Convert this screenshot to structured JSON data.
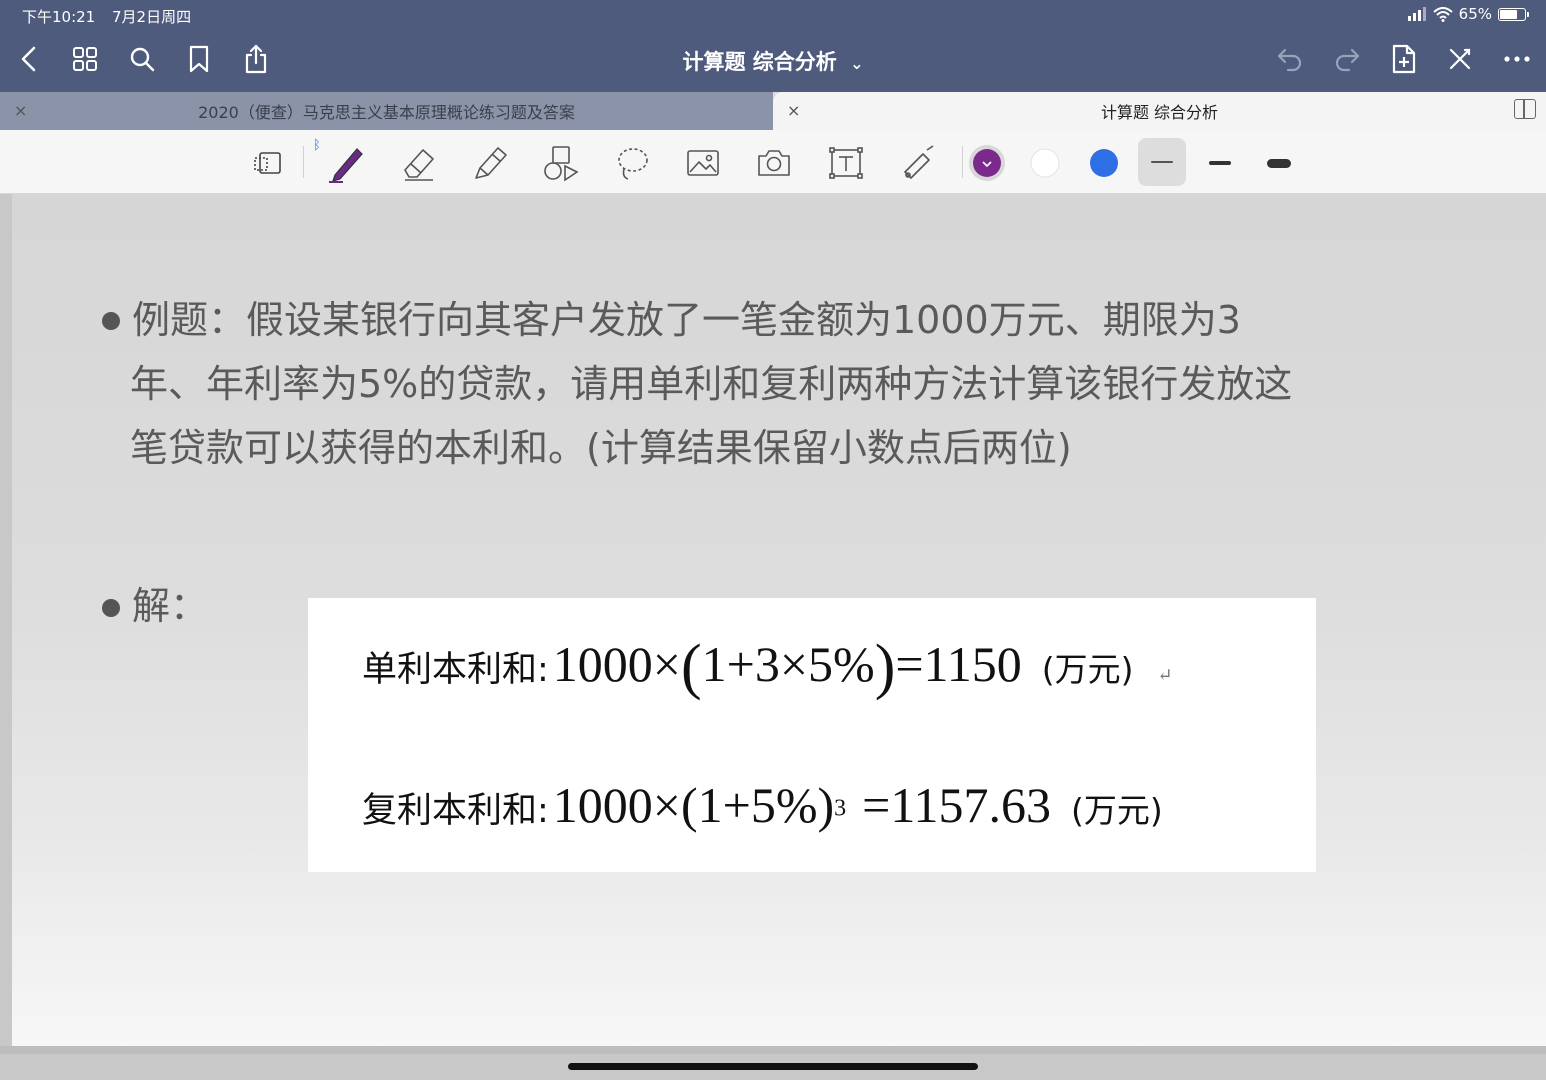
{
  "status_bar": {
    "time": "下午10:21",
    "date": "7月2日周四",
    "battery": "65%"
  },
  "nav": {
    "title": "计算题 综合分析",
    "title_chevron": "⌄"
  },
  "tabs": [
    {
      "label": "2020（便查）马克思主义基本原理概论练习题及答案",
      "active": false
    },
    {
      "label": "计算题 综合分析",
      "active": true
    }
  ],
  "tab_close": "×",
  "toolbar": {
    "tools": [
      "page-select-icon",
      "pen-icon",
      "eraser-icon",
      "highlighter-icon",
      "shapes-icon",
      "lasso-icon",
      "image-icon",
      "camera-icon",
      "text-box-icon",
      "laser-pointer-icon"
    ],
    "colors": [
      "#7b2a8c",
      "#ffffff",
      "#2f6fe6"
    ],
    "bluetooth_mark": "ᛒ"
  },
  "content": {
    "question": {
      "lines": [
        "例题：假设某银行向其客户发放了一笔金额为1000万元、期限为3",
        "年、年利率为5%的贷款，请用单利和复利两种方法计算该银行发放这",
        "笔贷款可以获得的本利和。(计算结果保留小数点后两位)"
      ]
    },
    "answer_label": "解：",
    "simple": {
      "label": "单利本利和:",
      "lhs": "1000×",
      "paren_open": "(",
      "inner": "1+3×5%",
      "paren_close": ")",
      "rhs": "=1150",
      "unit": "(万元)",
      "mark": "↵"
    },
    "compound": {
      "label": "复利本利和:",
      "lhs": "1000×(1+5%)",
      "exponent": "3",
      "rhs": "=1157.63",
      "unit": "(万元)"
    }
  }
}
